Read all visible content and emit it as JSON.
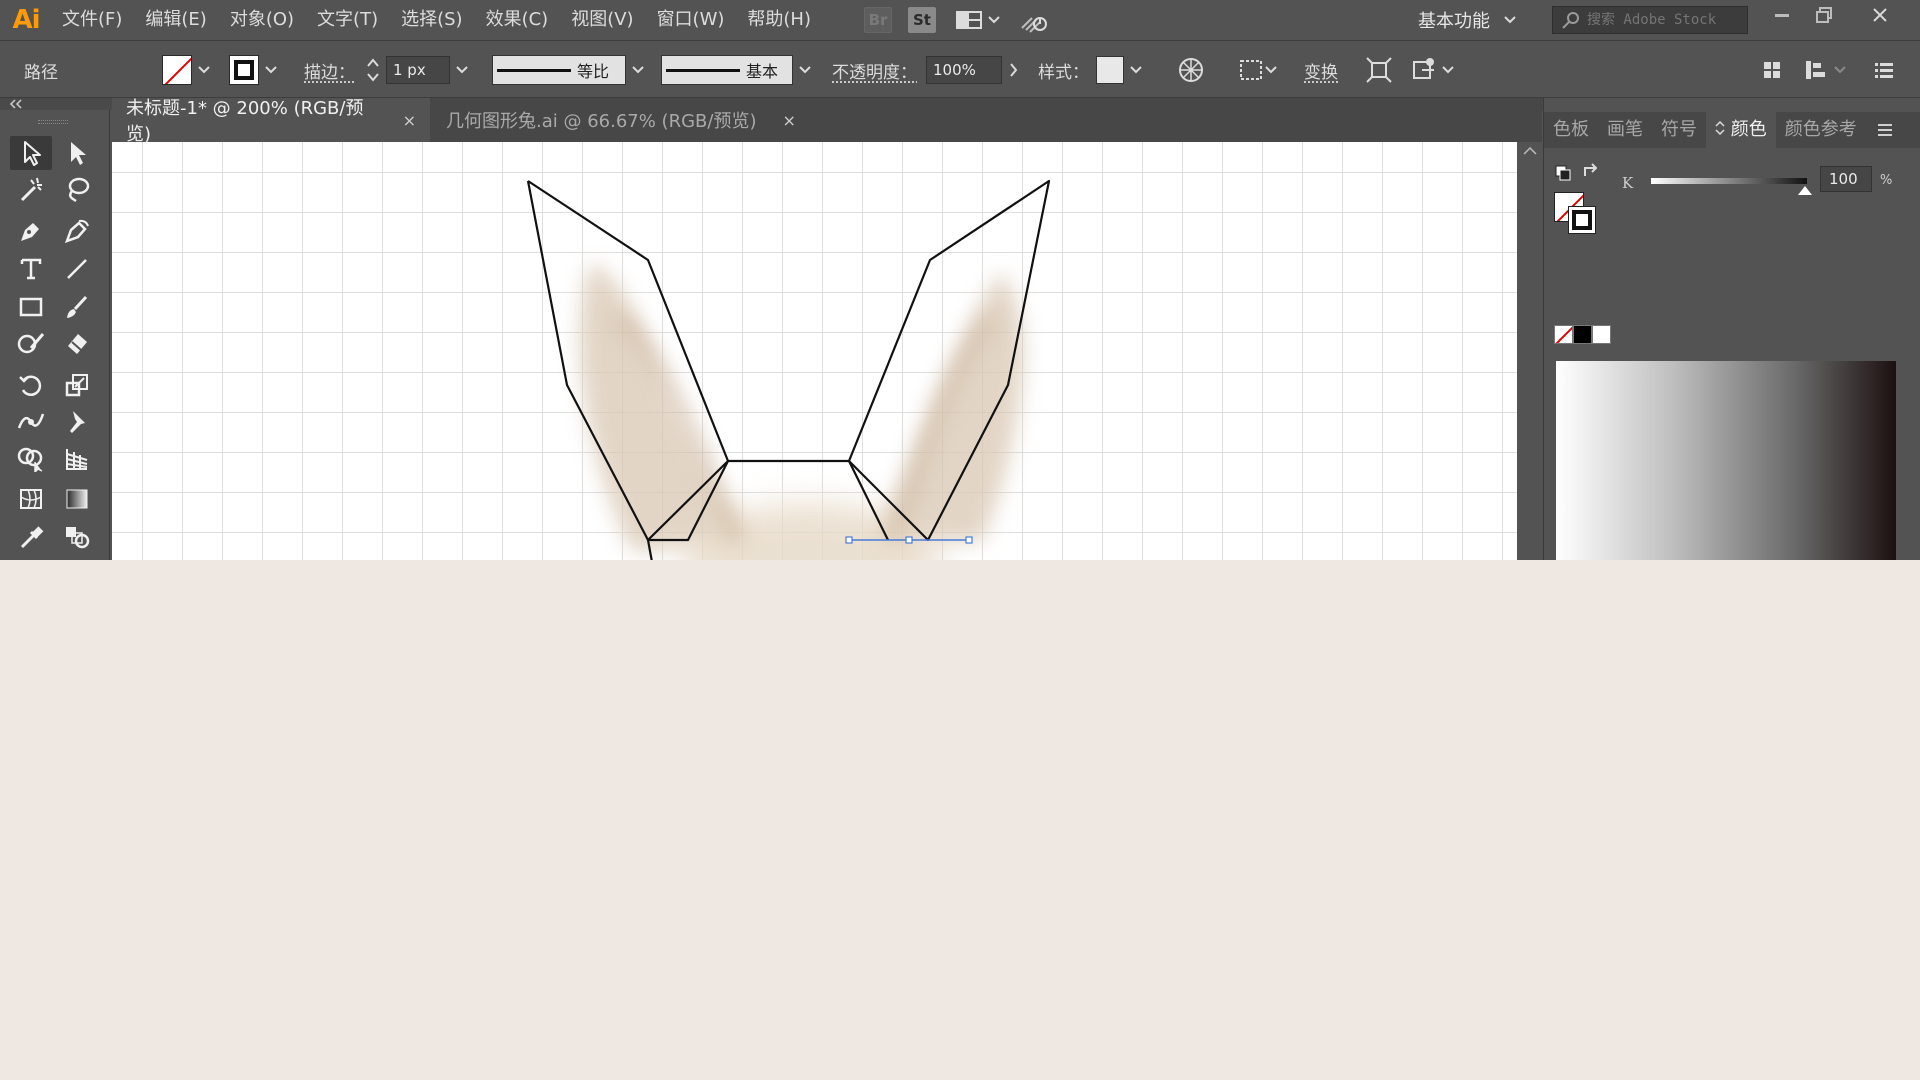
{
  "app": {
    "logo": "Ai",
    "menu": [
      "文件(F)",
      "编辑(E)",
      "对象(O)",
      "文字(T)",
      "选择(S)",
      "效果(C)",
      "视图(V)",
      "窗口(W)",
      "帮助(H)"
    ],
    "bridge_label": "Br",
    "stock_label": "St",
    "workspace": "基本功能",
    "search_placeholder": "搜索 Adobe Stock"
  },
  "control_bar": {
    "selection_type": "路径",
    "stroke_label": "描边：",
    "stroke_weight": "1 px",
    "profile_label": "等比",
    "brush_label": "基本",
    "opacity_label": "不透明度：",
    "opacity_value": "100%",
    "style_label": "样式：",
    "transform_label": "变换"
  },
  "documents": {
    "tabs": [
      {
        "label": "未标题-1* @ 200% (RGB/预览)",
        "active": true
      },
      {
        "label": "几何图形兔.ai @ 66.67% (RGB/预览)",
        "active": false
      }
    ],
    "close_glyph": "×"
  },
  "color_panel": {
    "tabs": [
      "色板",
      "画笔",
      "符号",
      "颜色",
      "颜色参考"
    ],
    "active_tab": "颜色",
    "channel_label": "K",
    "channel_value": "100",
    "channel_unit": "%",
    "channel_level": 1.0
  },
  "colors": {
    "chrome": "#535353",
    "canvas": "#ffffff",
    "logo": "#ff9a00",
    "desktop": "#efe7e1",
    "selection": "#4a7bd6"
  }
}
